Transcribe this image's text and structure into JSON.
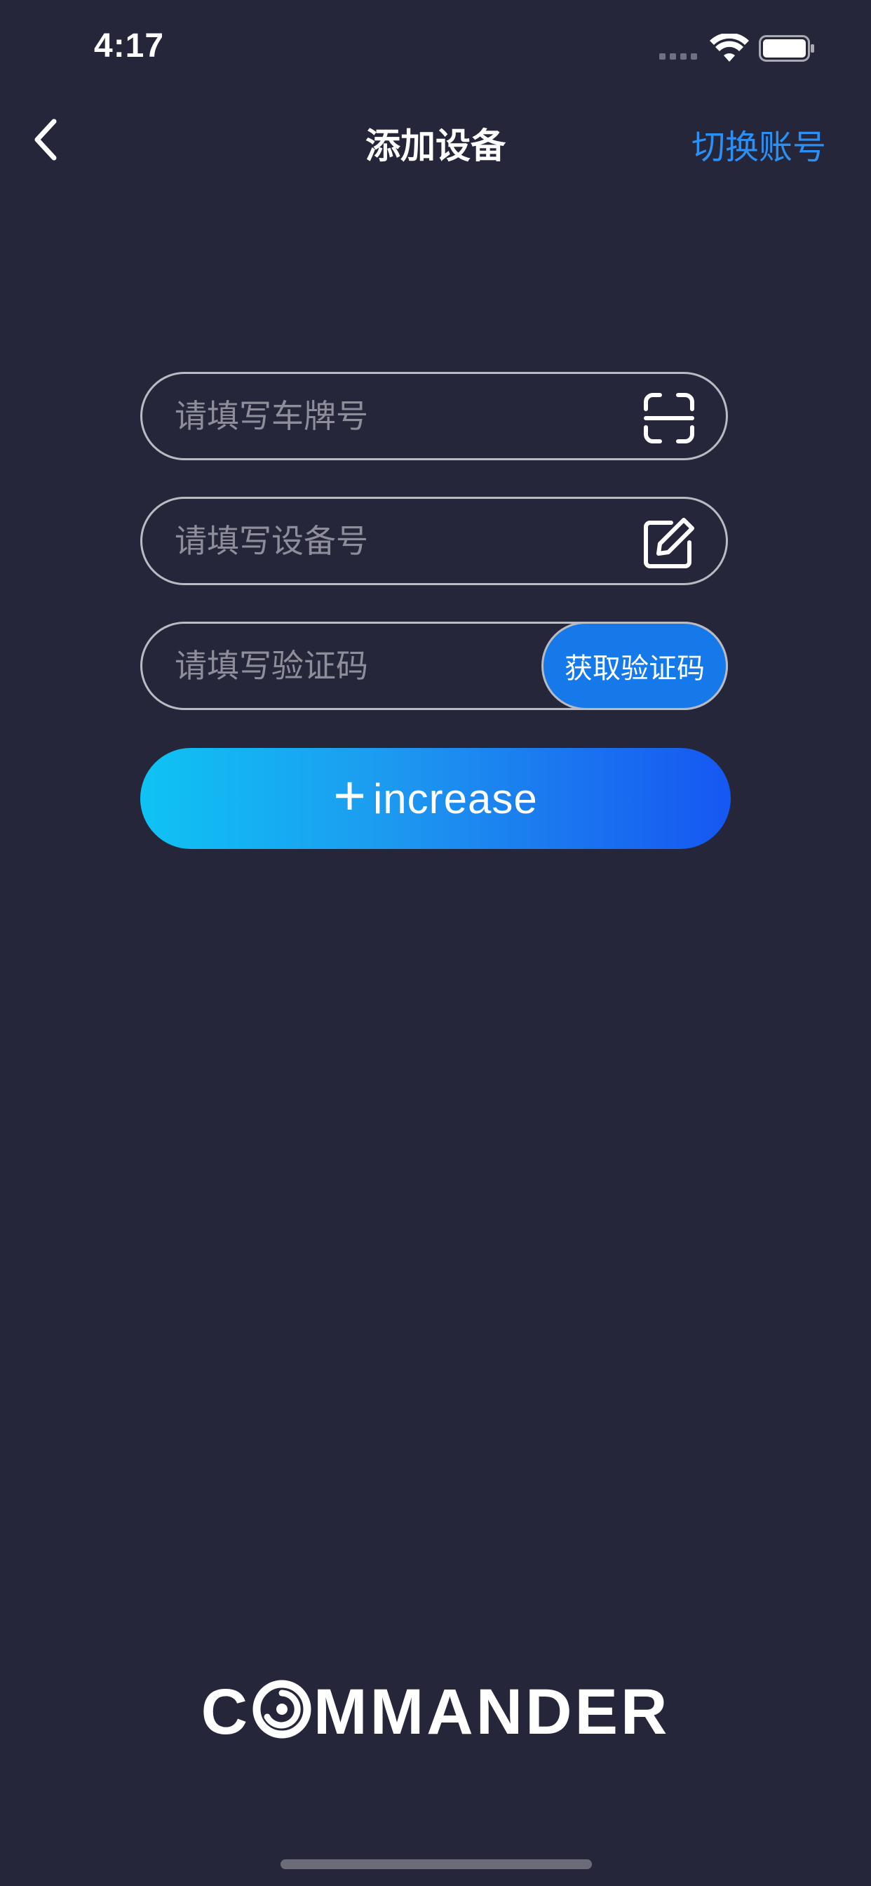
{
  "status_bar": {
    "time": "4:17"
  },
  "nav": {
    "title": "添加设备",
    "switch_account_label": "切换账号"
  },
  "form": {
    "plate_placeholder": "请填写车牌号",
    "device_placeholder": "请填写设备号",
    "code_placeholder": "请填写验证码",
    "get_code_label": "获取验证码",
    "increase_label": "increase",
    "increase_plus": "+"
  },
  "logo": {
    "prefix": "C",
    "suffix": "MMANDER"
  },
  "colors": {
    "background": "#25263a",
    "accent": "#2c8ff3",
    "code_button": "#1679ea",
    "gradient_start": "#0fc3f4",
    "gradient_end": "#1557f2"
  },
  "icons": {
    "back": "chevron-left-icon",
    "scan": "scan-icon",
    "edit": "edit-icon",
    "wifi": "wifi-icon",
    "battery": "battery-icon"
  }
}
